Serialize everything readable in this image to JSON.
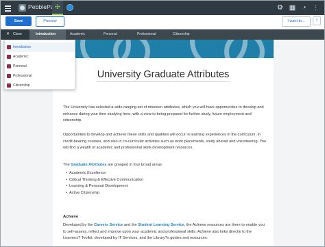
{
  "app": {
    "brand": "PebblePad"
  },
  "toolbar": {
    "save_label": "Save",
    "preview_label": "Preview",
    "i_want_to_label": "I want to...",
    "more_label": "⋮"
  },
  "nav": {
    "close_label": "Close",
    "items": [
      {
        "label": "Introduction",
        "active": true
      },
      {
        "label": "Academic"
      },
      {
        "label": "Personal"
      },
      {
        "label": "Professional"
      },
      {
        "label": "Citizenship"
      }
    ]
  },
  "dropdown": {
    "items": [
      {
        "label": "Introduction",
        "selected": true
      },
      {
        "label": "Academic"
      },
      {
        "label": "Personal"
      },
      {
        "label": "Professional"
      },
      {
        "label": "Citizenship"
      }
    ]
  },
  "page": {
    "title": "University Graduate Attributes",
    "p1": "The University has selected a wide-ranging set of nineteen attributes, which you will have opportunities to develop and enhance during your time studying here, with a view to being prepared for further study, future employment and citizenship.",
    "p2": "Opportunities to develop and achieve these skills and qualities will occur in learning experiences in the curriculum, in credit-bearing courses, and also in co-curricular activities such as work placements, study abroad and volunteering. You will find a wealth of academic and professional skills development resources.",
    "p3_pre": "The ",
    "p3_link": "Graduate Attributes",
    "p3_post": " are grouped in four broad areas:",
    "bullets": [
      "Academic Excellence",
      "Critical Thinking & Effective Communication",
      "Learning & Personal Development",
      "Active Citizenship"
    ],
    "achieve_heading": "Achieve",
    "p4_a": "Developed by the ",
    "p4_link1": "Careers Service",
    "p4_b": " and the ",
    "p4_link2": "Student Learning Service",
    "p4_c": ", the Achieve resources are there to enable you to self-assess, reflect and improve upon your academic and professional skills. Achieve also links directly to the Learners? Toolkit, developed by IT Services, and the Library?s guides and resources."
  },
  "icons": {
    "menu": "hamburger-menu-icon",
    "logo": "pebblepad-logo-icon",
    "asset": "asset-tab-icon",
    "globe": "globe-icon",
    "settings": "gear-icon",
    "grid": "grid-icon",
    "history": "history-icon",
    "more": "vertical-dots-icon",
    "close": "close-icon",
    "page": "page-icon"
  },
  "colors": {
    "accent": "#1f6fd1",
    "topbar": "#2f3a42",
    "navbar": "#3c474e",
    "link": "#1f7fb8",
    "banner": "#1f7fa8",
    "page_icon": "#8c2f4a"
  }
}
